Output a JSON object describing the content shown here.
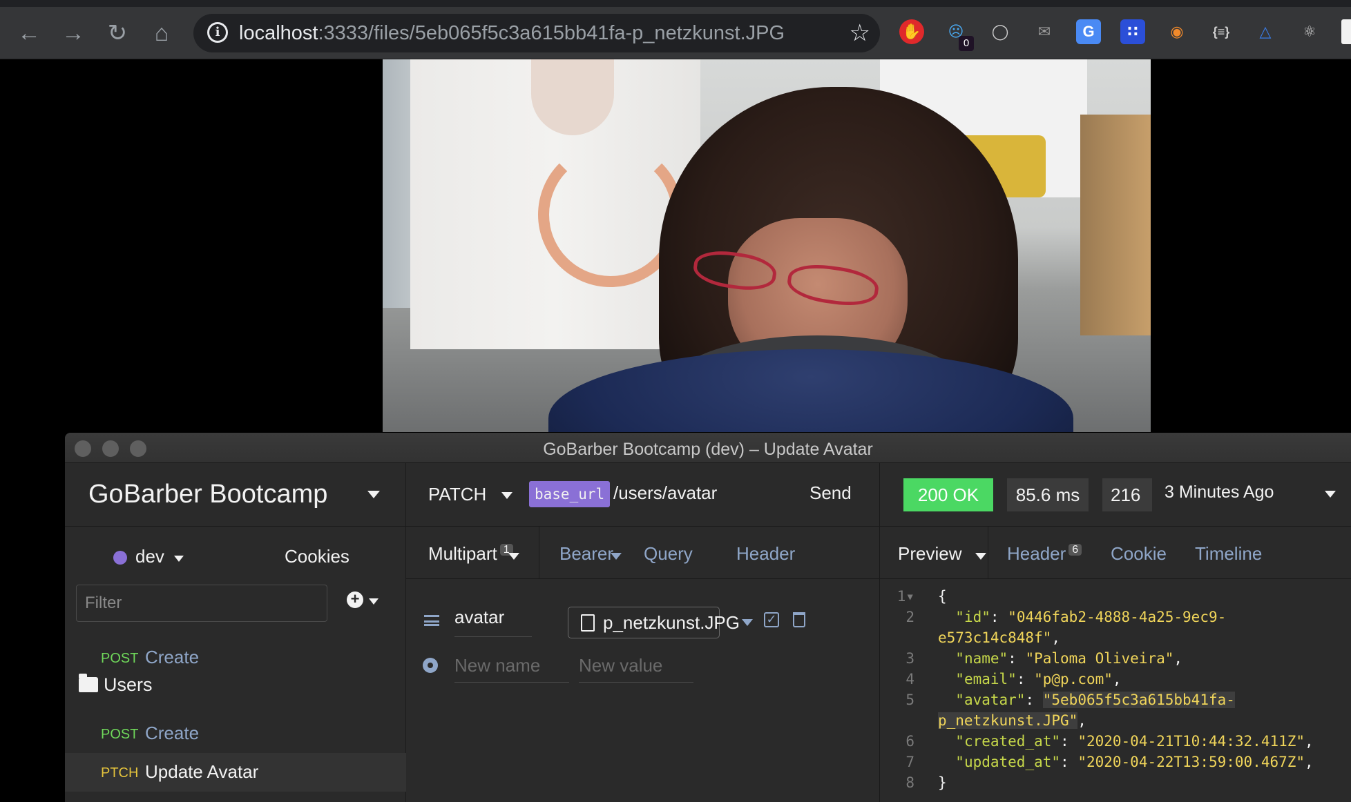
{
  "browser": {
    "url_host": "localhost",
    "url_rest": ":3333/files/5eb065f5c3a615bb41fa-p_netzkunst.JPG",
    "ext_badge": "0"
  },
  "window": {
    "title": "GoBarber Bootcamp (dev) – Update Avatar"
  },
  "sidebar": {
    "workspace": "GoBarber Bootcamp",
    "environment": "dev",
    "cookies": "Cookies",
    "filter_placeholder": "Filter",
    "items": [
      {
        "method": "POST",
        "name": "Create"
      },
      {
        "folder": "Users"
      },
      {
        "method": "POST",
        "name": "Create"
      },
      {
        "method": "PTCH",
        "name": "Update Avatar"
      }
    ]
  },
  "request": {
    "method": "PATCH",
    "variable": "base_url",
    "path": "/users/avatar",
    "send": "Send",
    "tabs": {
      "body": "Multipart",
      "body_count": "1",
      "auth": "Bearer",
      "query": "Query",
      "header": "Header"
    },
    "params": {
      "name": "avatar",
      "file": "p_netzkunst.JPG",
      "new_name_placeholder": "New name",
      "new_value_placeholder": "New value"
    }
  },
  "response": {
    "status": "200 OK",
    "time": "85.6 ms",
    "size": "216",
    "ago": "3 Minutes Ago",
    "tabs": {
      "preview": "Preview",
      "header": "Header",
      "header_count": "6",
      "cookie": "Cookie",
      "timeline": "Timeline"
    },
    "json": {
      "id_a": "\"0446fab2-4888-4a25-9ec9-",
      "id_b": "e573c14c848f\"",
      "name": "\"Paloma Oliveira\"",
      "email": "\"p@p.com\"",
      "avatar_a": "\"5eb065f5c3a615bb41fa-",
      "avatar_b": "p_netzkunst.JPG\"",
      "created_at": "\"2020-04-21T10:44:32.411Z\"",
      "updated_at": "\"2020-04-22T13:59:00.467Z\""
    }
  },
  "colors": {
    "accent_purple": "#8a70d6",
    "status_green": "#4bd863",
    "post_green": "#6fd75a",
    "patch_yellow": "#e3c23c"
  }
}
